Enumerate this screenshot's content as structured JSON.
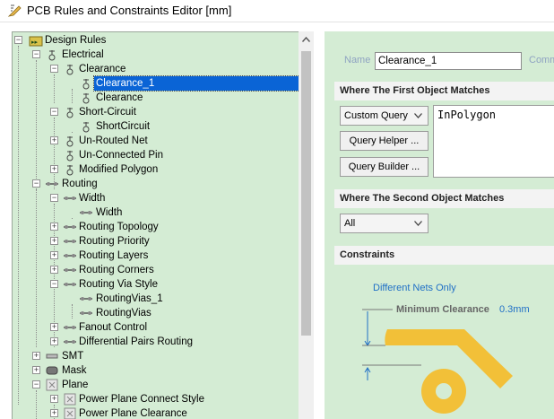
{
  "window": {
    "title": "PCB Rules and Constraints Editor [mm]"
  },
  "tree": {
    "items": [
      {
        "label": "Design Rules"
      },
      {
        "label": "Electrical"
      },
      {
        "label": "Clearance"
      },
      {
        "label": "Clearance_1",
        "selected": true
      },
      {
        "label": "Clearance"
      },
      {
        "label": "Short-Circuit"
      },
      {
        "label": "ShortCircuit"
      },
      {
        "label": "Un-Routed Net"
      },
      {
        "label": "Un-Connected Pin"
      },
      {
        "label": "Modified Polygon"
      },
      {
        "label": "Routing"
      },
      {
        "label": "Width"
      },
      {
        "label": "Width"
      },
      {
        "label": "Routing Topology"
      },
      {
        "label": "Routing Priority"
      },
      {
        "label": "Routing Layers"
      },
      {
        "label": "Routing Corners"
      },
      {
        "label": "Routing Via Style"
      },
      {
        "label": "RoutingVias_1"
      },
      {
        "label": "RoutingVias"
      },
      {
        "label": "Fanout Control"
      },
      {
        "label": "Differential Pairs Routing"
      },
      {
        "label": "SMT"
      },
      {
        "label": "Mask"
      },
      {
        "label": "Plane"
      },
      {
        "label": "Power Plane Connect Style"
      },
      {
        "label": "Power Plane Clearance"
      }
    ]
  },
  "rule": {
    "name_label": "Name",
    "name_value": "Clearance_1",
    "comment_label": "Comm"
  },
  "first_match": {
    "header": "Where The First Object Matches",
    "query_kind": "Custom Query",
    "query_helper": "Query Helper ...",
    "query_builder": "Query Builder ...",
    "query_text": "InPolygon"
  },
  "second_match": {
    "header": "Where The Second Object Matches",
    "selected": "All"
  },
  "constraints": {
    "header": "Constraints",
    "net_scope": "Different Nets Only",
    "min_clearance_label": "Minimum Clearance",
    "min_clearance_value": "0.3mm"
  },
  "colors": {
    "panel_bg": "#d4ecd4",
    "selection": "#0a64d6",
    "diagram_copper": "#f2c038",
    "diagram_text": "#1f6fc6"
  }
}
